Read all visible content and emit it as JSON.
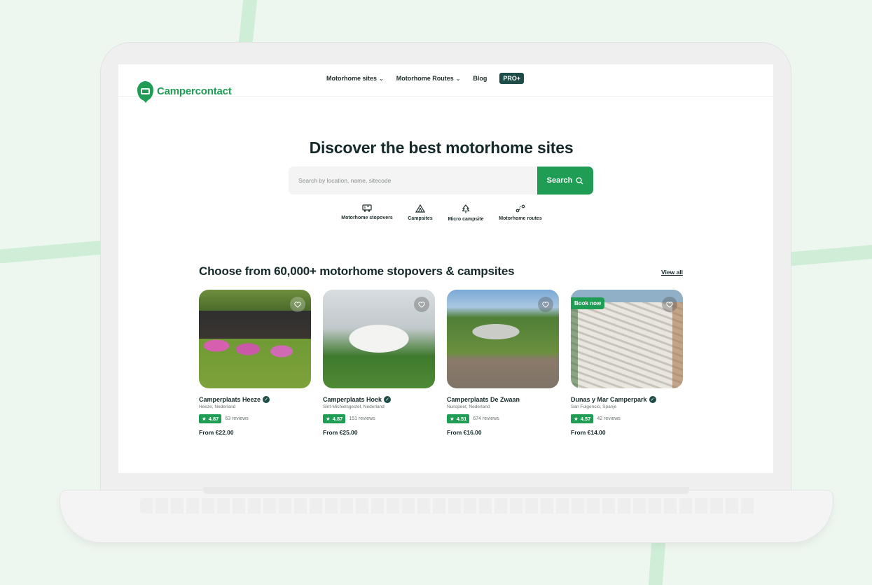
{
  "brand": {
    "name": "Campercontact",
    "color": "#1f9d55",
    "dark": "#1e4d47"
  },
  "nav": {
    "items": [
      {
        "label": "Motorhome sites",
        "has_dropdown": true
      },
      {
        "label": "Motorhome Routes",
        "has_dropdown": true
      },
      {
        "label": "Blog",
        "has_dropdown": false
      }
    ],
    "pro_label": "PRO+"
  },
  "hero": {
    "title": "Discover the best motorhome sites",
    "search_placeholder": "Search by location, name, sitecode",
    "search_button": "Search"
  },
  "categories": [
    {
      "label": "Motorhome stopovers",
      "icon": "motorhome-icon"
    },
    {
      "label": "Campsites",
      "icon": "tent-icon"
    },
    {
      "label": "Micro campsite",
      "icon": "tree-icon"
    },
    {
      "label": "Motorhome routes",
      "icon": "route-icon"
    }
  ],
  "section": {
    "title": "Choose from 60,000+ motorhome stopovers & campsites",
    "view_all": "View all"
  },
  "cards": [
    {
      "name": "Camperplaats Heeze",
      "location": "Heeze, Nederland",
      "rating": "4.87",
      "reviews": "63 reviews",
      "price": "From €22.00",
      "badge": ""
    },
    {
      "name": "Camperplaats Hoek",
      "location": "Sint-Michielsgestel, Nederland",
      "rating": "4.87",
      "reviews": "151 reviews",
      "price": "From €25.00",
      "badge": ""
    },
    {
      "name": "Camperplaats De Zwaan",
      "location": "Nunspeet, Nederland",
      "rating": "4.51",
      "reviews": "674 reviews",
      "price": "From €16.00",
      "badge": ""
    },
    {
      "name": "Dunas y Mar Camperpark",
      "location": "San Fulgencio, Spanje",
      "rating": "4.57",
      "reviews": "42 reviews",
      "price": "From €14.00",
      "badge": "Book now"
    }
  ]
}
